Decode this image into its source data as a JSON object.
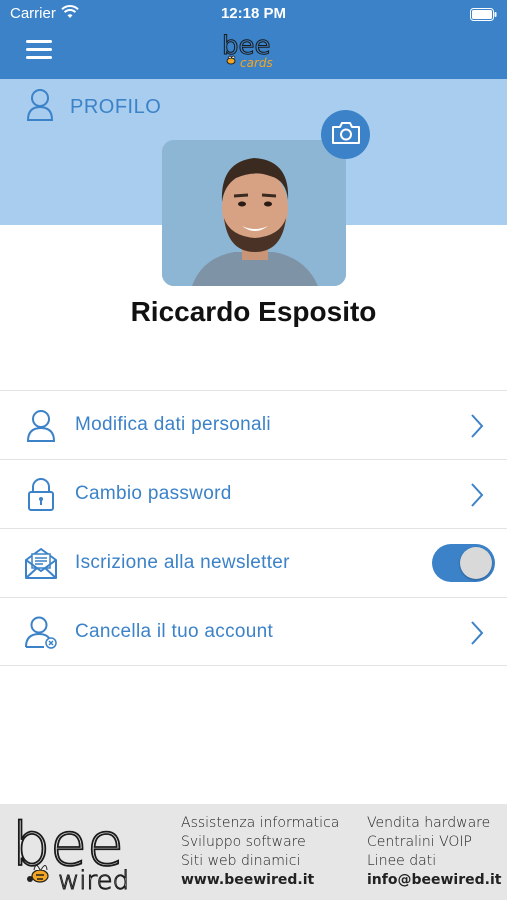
{
  "status_bar": {
    "carrier": "Carrier",
    "time": "12:18 PM"
  },
  "nav": {
    "menu_icon": "hamburger-menu-icon",
    "logo": {
      "brand": "bee",
      "sub": "cards"
    }
  },
  "profile": {
    "section_label": "PROFILO",
    "section_icon": "user-icon",
    "camera_icon": "camera-icon",
    "user_name": "Riccardo Esposito"
  },
  "menu": {
    "items": [
      {
        "label": "Modifica dati personali",
        "icon": "user-icon",
        "type": "link"
      },
      {
        "label": "Cambio password",
        "icon": "lock-icon",
        "type": "link"
      },
      {
        "label": "Iscrizione alla newsletter",
        "icon": "newsletter-envelope-icon",
        "type": "toggle",
        "enabled": true
      },
      {
        "label": "Cancella il tuo account",
        "icon": "delete-user-icon",
        "type": "link"
      }
    ]
  },
  "footer": {
    "logo": {
      "brand": "bee",
      "sub": "wired"
    },
    "col1": [
      "Assistenza informatica",
      "Sviluppo software",
      "Siti web dinamici",
      "www.beewired.it"
    ],
    "col2": [
      "Vendita hardware",
      "Centralini VOIP",
      "Linee dati",
      "info@beewired.it"
    ]
  },
  "colors": {
    "primary": "#3b82c8",
    "band": "#a8cdee",
    "footer_bg": "#e6e6e6",
    "bee_yellow": "#f2a623"
  }
}
